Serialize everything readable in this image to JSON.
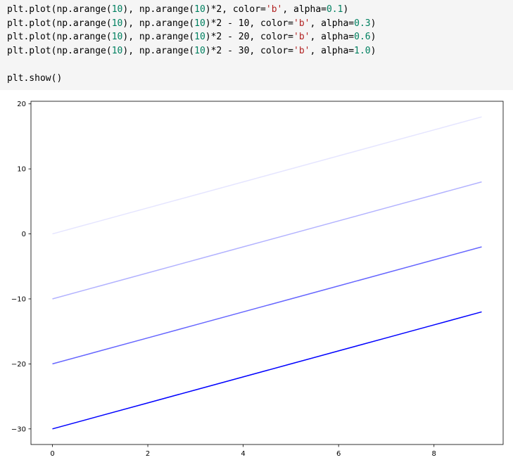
{
  "code": {
    "lines": [
      [
        {
          "t": "plt.plot(np.arange(",
          "k": "plain"
        },
        {
          "t": "10",
          "k": "num"
        },
        {
          "t": "), np.arange(",
          "k": "plain"
        },
        {
          "t": "10",
          "k": "num"
        },
        {
          "t": ")*2, color=",
          "k": "plain"
        },
        {
          "t": "'b'",
          "k": "str"
        },
        {
          "t": ", alpha=",
          "k": "plain"
        },
        {
          "t": "0.1",
          "k": "num"
        },
        {
          "t": ")",
          "k": "plain"
        }
      ],
      [
        {
          "t": "plt.plot(np.arange(",
          "k": "plain"
        },
        {
          "t": "10",
          "k": "num"
        },
        {
          "t": "), np.arange(",
          "k": "plain"
        },
        {
          "t": "10",
          "k": "num"
        },
        {
          "t": ")*2 - 10, color=",
          "k": "plain"
        },
        {
          "t": "'b'",
          "k": "str"
        },
        {
          "t": ", alpha=",
          "k": "plain"
        },
        {
          "t": "0.3",
          "k": "num"
        },
        {
          "t": ")",
          "k": "plain"
        }
      ],
      [
        {
          "t": "plt.plot(np.arange(",
          "k": "plain"
        },
        {
          "t": "10",
          "k": "num"
        },
        {
          "t": "), np.arange(",
          "k": "plain"
        },
        {
          "t": "10",
          "k": "num"
        },
        {
          "t": ")*2 - 20, color=",
          "k": "plain"
        },
        {
          "t": "'b'",
          "k": "str"
        },
        {
          "t": ", alpha=",
          "k": "plain"
        },
        {
          "t": "0.6",
          "k": "num"
        },
        {
          "t": ")",
          "k": "plain"
        }
      ],
      [
        {
          "t": "plt.plot(np.arange(",
          "k": "plain"
        },
        {
          "t": "10",
          "k": "num"
        },
        {
          "t": "), np.arange(",
          "k": "plain"
        },
        {
          "t": "10",
          "k": "num"
        },
        {
          "t": ")*2 - 30, color=",
          "k": "plain"
        },
        {
          "t": "'b'",
          "k": "str"
        },
        {
          "t": ", alpha=",
          "k": "plain"
        },
        {
          "t": "1.0",
          "k": "num"
        },
        {
          "t": ")",
          "k": "plain"
        }
      ],
      [],
      [
        {
          "t": "plt.show()",
          "k": "plain"
        }
      ]
    ]
  },
  "chart_data": {
    "type": "line",
    "x": [
      0,
      1,
      2,
      3,
      4,
      5,
      6,
      7,
      8,
      9
    ],
    "series": [
      {
        "values": [
          0,
          2,
          4,
          6,
          8,
          10,
          12,
          14,
          16,
          18
        ],
        "color": "#0000ff",
        "alpha": 0.1
      },
      {
        "values": [
          -10,
          -8,
          -6,
          -4,
          -2,
          0,
          2,
          4,
          6,
          8
        ],
        "color": "#0000ff",
        "alpha": 0.3
      },
      {
        "values": [
          -20,
          -18,
          -16,
          -14,
          -12,
          -10,
          -8,
          -6,
          -4,
          -2
        ],
        "color": "#0000ff",
        "alpha": 0.6
      },
      {
        "values": [
          -30,
          -28,
          -26,
          -24,
          -22,
          -20,
          -18,
          -16,
          -14,
          -12
        ],
        "color": "#0000ff",
        "alpha": 1.0
      }
    ],
    "xlim": [
      -0.45,
      9.45
    ],
    "ylim": [
      -32.4,
      20.4
    ],
    "xticks": [
      0,
      2,
      4,
      6,
      8
    ],
    "yticks": [
      20,
      10,
      0,
      -10,
      -20,
      -30
    ],
    "xtick_labels": [
      "0",
      "2",
      "4",
      "6",
      "8"
    ],
    "ytick_labels": [
      "20",
      "10",
      "0",
      "−10",
      "−20",
      "−30"
    ],
    "grid": false,
    "title": "",
    "xlabel": "",
    "ylabel": ""
  }
}
